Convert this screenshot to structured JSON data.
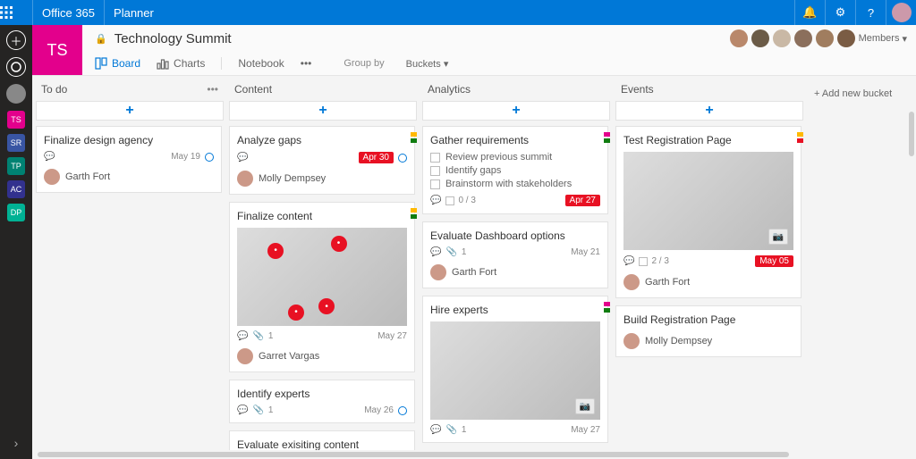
{
  "topbar": {
    "brand": "Office 365",
    "app": "Planner"
  },
  "rail_tiles": [
    {
      "label": "TS",
      "color": "#e3008c"
    },
    {
      "label": "SR",
      "color": "#3955a3"
    },
    {
      "label": "TP",
      "color": "#008272"
    },
    {
      "label": "AC",
      "color": "#32318e"
    },
    {
      "label": "DP",
      "color": "#00b294"
    }
  ],
  "plan": {
    "tile": "TS",
    "title": "Technology Summit",
    "members_label": "Members"
  },
  "views": {
    "board": "Board",
    "charts": "Charts",
    "notebook": "Notebook",
    "groupby_label": "Group by",
    "groupby_value": "Buckets"
  },
  "add_bucket": "+ Add new bucket",
  "columns": [
    {
      "name": "To do",
      "show_dots": true,
      "cards": [
        {
          "title": "Finalize design agency",
          "date": "May 19",
          "bubble": true,
          "assignee": "Garth Fort",
          "tags": []
        }
      ]
    },
    {
      "name": "Content",
      "cards": [
        {
          "title": "Analyze gaps",
          "datepill": "Apr 30",
          "bubble": true,
          "assignee": "Molly Dempsey",
          "tags": [
            "#ffb900",
            "#107c10"
          ]
        },
        {
          "title": "Finalize content",
          "image": true,
          "image_dots": 4,
          "attach": "1",
          "date": "May 27",
          "assignee": "Garret Vargas",
          "tags": [
            "#ffb900",
            "#107c10"
          ]
        },
        {
          "title": "Identify experts",
          "attach": "1",
          "date": "May 26",
          "bubble": true
        },
        {
          "title": "Evaluate exisiting content"
        }
      ]
    },
    {
      "name": "Analytics",
      "cards": [
        {
          "title": "Gather requirements",
          "tags": [
            "#e3008c",
            "#107c10"
          ],
          "checklist": [
            "Review previous summit",
            "Identify gaps",
            "Brainstorm with stakeholders"
          ],
          "check_count": "0 / 3",
          "datepill": "Apr 27"
        },
        {
          "title": "Evaluate Dashboard options",
          "attach": "1",
          "date": "May 21",
          "assignee": "Garth Fort"
        },
        {
          "title": "Hire experts",
          "image": true,
          "camera": true,
          "attach": "1",
          "date": "May 27",
          "tags": [
            "#e3008c",
            "#107c10"
          ]
        }
      ]
    },
    {
      "name": "Events",
      "cards": [
        {
          "title": "Test Registration Page",
          "image": true,
          "camera": true,
          "tags": [
            "#ffb900",
            "#e81123"
          ],
          "attach": "",
          "check_count": "2 / 3",
          "datepill": "May 05",
          "assignee": "Garth Fort"
        },
        {
          "title": "Build Registration Page",
          "assignee": "Molly Dempsey"
        }
      ]
    }
  ]
}
